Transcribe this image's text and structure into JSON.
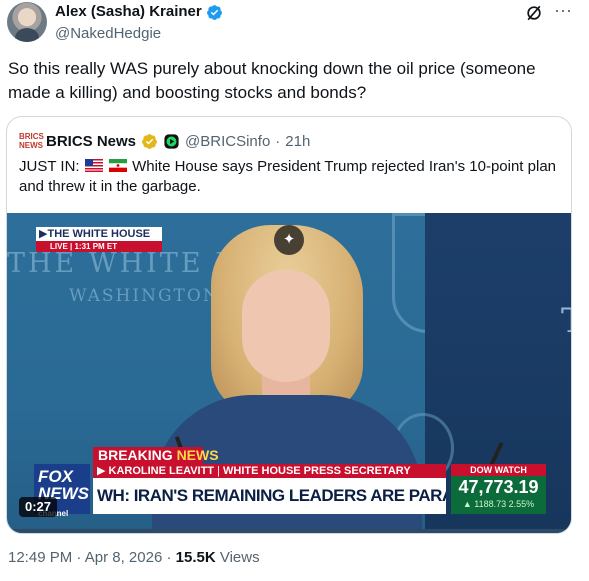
{
  "author": {
    "name": "Alex (Sasha) Krainer",
    "handle": "@NakedHedgie",
    "verified": true,
    "verified_color": "#1d9bf0"
  },
  "header_actions": {
    "grok_icon": "grok-slash-icon",
    "more_icon": "more-dots-icon",
    "more_glyph": "···"
  },
  "tweet": {
    "text": "So this really WAS purely about knocking down the oil price (someone made a killing) and boosting stocks and bonds?"
  },
  "quote": {
    "logo_text": "BRICS NEWS",
    "name": "BRICS News",
    "handle": "@BRICSinfo",
    "separator": "·",
    "time": "21h",
    "text_prefix": "JUST IN:",
    "text_body": "White House says President Trump rejected Iran's 10-point plan and threw it in the garbage.",
    "flags": [
      "us-flag",
      "iran-flag"
    ],
    "badge_color": "#e2b719"
  },
  "video": {
    "bug_title": "THE WHITE HOUSE",
    "bug_live": "LIVE",
    "bug_time": "1:31 PM ET",
    "wall_text": "THE WHITE HOUSE",
    "wall_sub": "WASHINGTON",
    "breaking_1": "BREAKING",
    "breaking_2": "NEWS",
    "nameplate_name": "KAROLINE LEAVITT",
    "nameplate_title": "WHITE HOUSE PRESS SECRETARY",
    "headline": "WH: IRAN'S REMAINING LEADERS ARE PARALYZED IN FEAR",
    "fox_logo_1": "FOX",
    "fox_logo_2": "NEWS",
    "fox_logo_3": "channel",
    "dow_label": "DOW WATCH",
    "dow_value": "47,773.19",
    "dow_change": "▲ 1188.73 2.55%",
    "duration": "0:27",
    "progress": 0.0,
    "sparkle_icon": "sparkle-icon"
  },
  "meta": {
    "time": "12:49 PM",
    "separator": "·",
    "date": "Apr 8, 2026",
    "views_count": "15.5K",
    "views_label": "Views"
  }
}
